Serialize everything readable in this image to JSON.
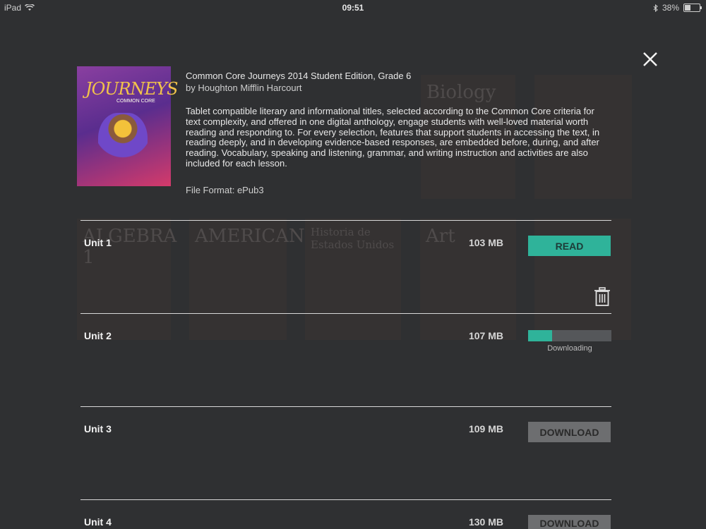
{
  "status_bar": {
    "device": "iPad",
    "time": "09:51",
    "battery": "38%",
    "bluetooth_icon": "bluetooth-icon",
    "wifi_icon": "wifi-icon"
  },
  "background_covers": [
    "Biology",
    "ALGEBRA 1",
    "AMERICAN",
    "Historia de Estados Unidos",
    "Art"
  ],
  "book": {
    "title": "Common Core Journeys 2014 Student Edition, Grade 6",
    "author": "by Houghton Mifflin Harcourt",
    "description": "Tablet compatible literary and informational titles, selected according to the Common Core criteria for text complexity, and offered in one digital anthology, engage students with well-loved material worth reading and responding to. For every selection, features that support students in accessing the text, in reading deeply, and in developing evidence-based responses, are embedded before, during, and after reading. Vocabulary, speaking and listening, grammar, and writing instruction and activities are also included for each lesson.",
    "file_format": "File Format: ePub3",
    "cover_title": "JOURNEYS",
    "cover_subtitle": "COMMON CORE"
  },
  "units": [
    {
      "name": "Unit 1",
      "size": "103 MB",
      "action": "READ"
    },
    {
      "name": "Unit 2",
      "size": "107 MB",
      "status": "Downloading",
      "progress": 0.29
    },
    {
      "name": "Unit 3",
      "size": "109 MB",
      "action": "DOWNLOAD"
    },
    {
      "name": "Unit 4",
      "size": "130 MB",
      "action": "DOWNLOAD"
    }
  ],
  "colors": {
    "accent": "#2fb39a",
    "background": "#2f3032",
    "button_disabled": "#6d6e70"
  }
}
